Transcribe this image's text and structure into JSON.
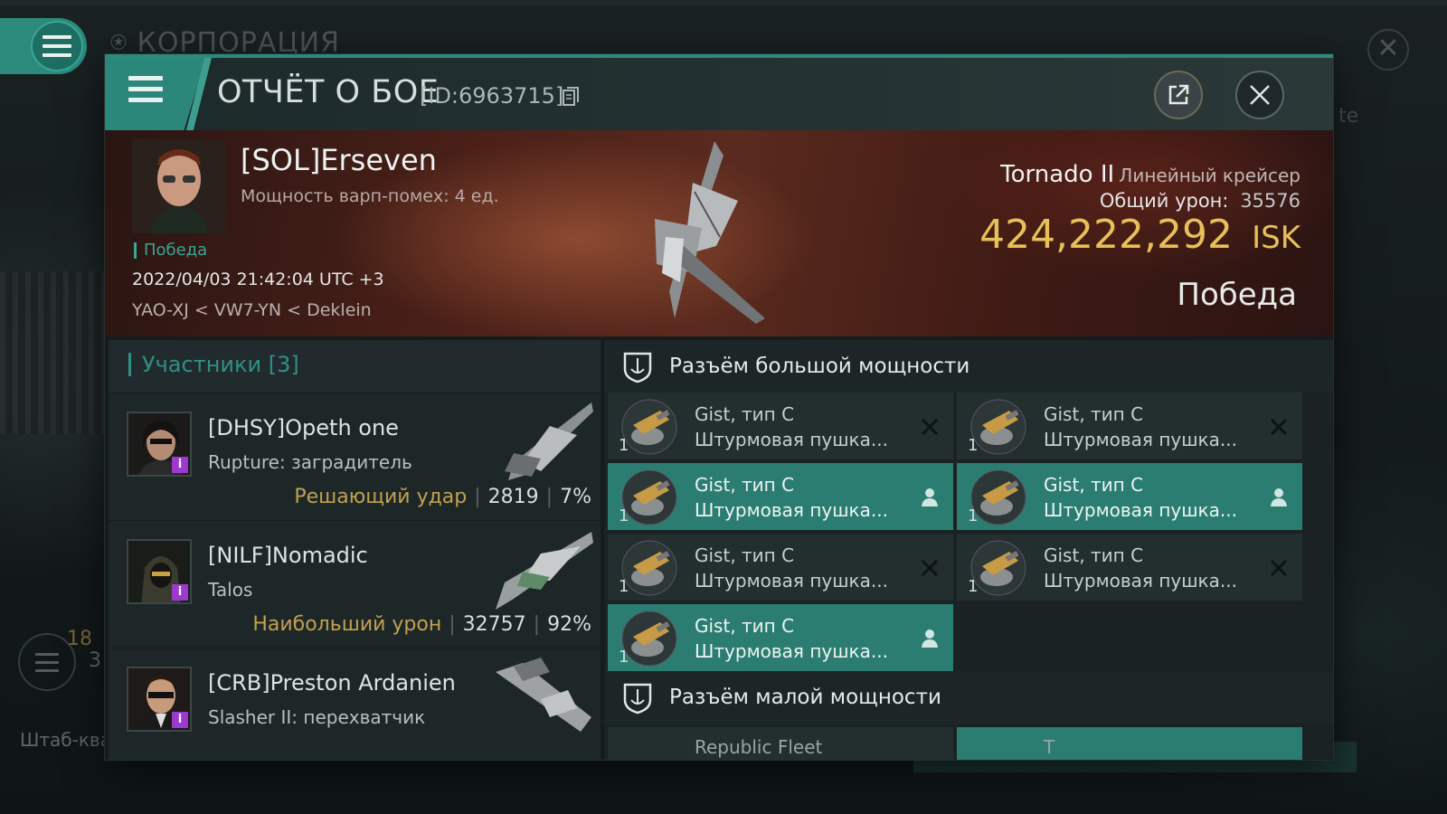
{
  "background": {
    "title": "КОРПОРАЦИЯ",
    "side_text": "te",
    "count_a": "18",
    "count_b": "3",
    "bottom_text": "Штаб-ква"
  },
  "header": {
    "title": "ОТЧЁТ О БОЕ",
    "report_id": "[ID:6963715]"
  },
  "victim": {
    "name": "[SOL]Erseven",
    "warp_strength": "Мощность варп-помех: 4 ед.",
    "status": "Победа",
    "datetime": "2022/04/03 21:42:04 UTC +3",
    "location": "YAO-XJ < VW7-YN < Deklein",
    "ship_name": "Tornado II",
    "ship_class": "Линейный крейсер",
    "total_damage_label": "Общий урон:",
    "total_damage": "35576",
    "isk_value": "424,222,292",
    "isk_unit": "ISK",
    "result": "Победа"
  },
  "participants": {
    "label": "Участники",
    "count": "[3]",
    "list": [
      {
        "name": "[DHSY]Opeth one",
        "ship": "Rupture: заградитель",
        "tag": "Решающий удар",
        "damage": "2819",
        "percent": "7%"
      },
      {
        "name": "[NILF]Nomadic",
        "ship": "Talos",
        "tag": "Наибольший урон",
        "damage": "32757",
        "percent": "92%"
      },
      {
        "name": "[CRB]Preston Ardanien",
        "ship": "Slasher II: перехватчик",
        "tag": "",
        "damage": "",
        "percent": ""
      }
    ]
  },
  "fitting": {
    "high_slots_label": "Разъём большой мощности",
    "low_slots_label": "Разъём малой мощности",
    "modules": [
      {
        "name": "Gist, тип C",
        "type": "Штурмовая пушка...",
        "qty": "1",
        "state": "destroyed"
      },
      {
        "name": "Gist, тип C",
        "type": "Штурмовая пушка...",
        "qty": "1",
        "state": "destroyed"
      },
      {
        "name": "Gist, тип C",
        "type": "Штурмовая пушка...",
        "qty": "1",
        "state": "dropped"
      },
      {
        "name": "Gist, тип C",
        "type": "Штурмовая пушка...",
        "qty": "1",
        "state": "dropped"
      },
      {
        "name": "Gist, тип C",
        "type": "Штурмовая пушка...",
        "qty": "1",
        "state": "destroyed"
      },
      {
        "name": "Gist, тип C",
        "type": "Штурмовая пушка...",
        "qty": "1",
        "state": "destroyed"
      },
      {
        "name": "Gist, тип C",
        "type": "Штурмовая пушка...",
        "qty": "1",
        "state": "dropped"
      }
    ],
    "low_partial_a": "Republic Fleet",
    "low_partial_b": "T"
  },
  "colors": {
    "accent_teal": "#2b8a7c",
    "isk_gold": "#e8c058",
    "tag_gold": "#c2a050",
    "corp_badge_purple": "#9c3ad0"
  },
  "icons": {
    "menu": "hamburger-icon",
    "copy": "copy-icon",
    "share": "external-link-icon",
    "close": "close-icon",
    "slot": "shield-slot-icon",
    "destroyed": "x-icon",
    "dropped": "person-icon"
  }
}
